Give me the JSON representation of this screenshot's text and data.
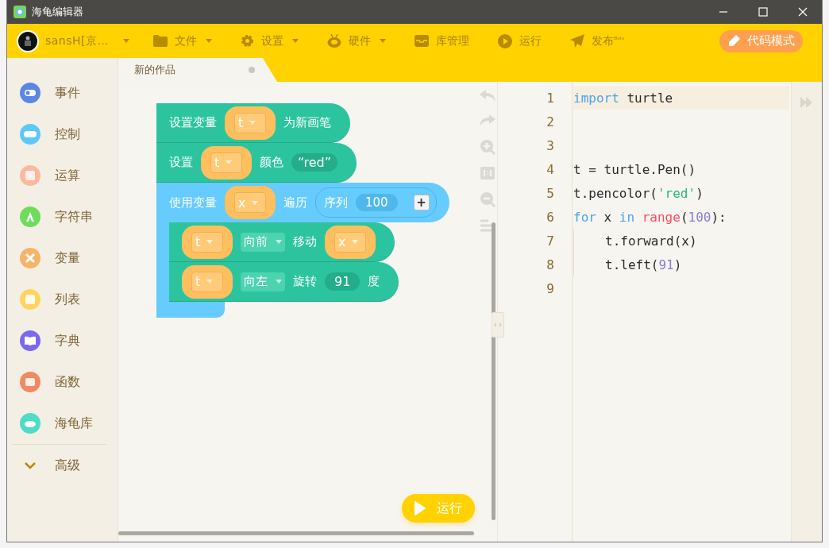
{
  "window": {
    "title": "海龟编辑器"
  },
  "toolbar": {
    "user": {
      "name": "sansH[京…",
      "has_menu": true
    },
    "items": [
      {
        "label": "文件",
        "has_menu": true
      },
      {
        "label": "设置",
        "has_menu": true
      },
      {
        "label": "硬件",
        "has_menu": true
      },
      {
        "label": "库管理",
        "has_menu": false
      },
      {
        "label": "运行",
        "has_menu": false
      },
      {
        "label": "发布",
        "has_menu": false,
        "badge": "Beta"
      }
    ],
    "mode_button": "代码模式"
  },
  "tabs": [
    {
      "label": "新的作品",
      "selected": true
    }
  ],
  "categories": [
    {
      "label": "事件",
      "color": "#5b86e5"
    },
    {
      "label": "控制",
      "color": "#5cc8f8"
    },
    {
      "label": "运算",
      "color": "#f9b9a0"
    },
    {
      "label": "字符串",
      "color": "#6fdc5c"
    },
    {
      "label": "变量",
      "color": "#f5b46a"
    },
    {
      "label": "列表",
      "color": "#ffd45e"
    },
    {
      "label": "字典",
      "color": "#7b68ee"
    },
    {
      "label": "函数",
      "color": "#ef8a62"
    },
    {
      "label": "海龟库",
      "color": "#4fdcc4"
    }
  ],
  "advanced": {
    "label": "高级",
    "expanded": false
  },
  "blocks": [
    {
      "kind": "statement",
      "parts": [
        {
          "kind": "text",
          "text": "设置变量"
        },
        {
          "kind": "var",
          "text": "t"
        },
        {
          "kind": "text",
          "text": "为新画笔"
        }
      ]
    },
    {
      "kind": "statement",
      "parts": [
        {
          "kind": "text",
          "text": "设置"
        },
        {
          "kind": "var",
          "text": "t"
        },
        {
          "kind": "text",
          "text": "颜色"
        },
        {
          "kind": "string",
          "text": "“red”"
        }
      ]
    },
    {
      "kind": "loop",
      "parts": [
        {
          "kind": "text",
          "text": "使用变量"
        },
        {
          "kind": "var",
          "text": "x"
        },
        {
          "kind": "text",
          "text": "遍历"
        },
        {
          "kind": "sequence",
          "text": "序列",
          "value": "100",
          "plus": "+"
        }
      ],
      "children": [
        {
          "kind": "statement",
          "parts": [
            {
              "kind": "var",
              "text": "t"
            },
            {
              "kind": "dropdown",
              "text": "向前"
            },
            {
              "kind": "text",
              "text": "移动"
            },
            {
              "kind": "var",
              "text": "x"
            }
          ]
        },
        {
          "kind": "statement",
          "parts": [
            {
              "kind": "var",
              "text": "t"
            },
            {
              "kind": "dropdown",
              "text": "向左"
            },
            {
              "kind": "text",
              "text": "旋转"
            },
            {
              "kind": "number",
              "text": "91"
            },
            {
              "kind": "text",
              "text": "度"
            }
          ]
        }
      ]
    }
  ],
  "run_button": "运行",
  "code": [
    {
      "number": "1",
      "selected": true,
      "tokens": [
        {
          "kind": "keyword",
          "text": "import"
        },
        {
          "kind": "plain",
          "text": " turtle"
        }
      ]
    },
    {
      "number": "2",
      "selected": false
    },
    {
      "number": "3",
      "selected": false
    },
    {
      "number": "4",
      "selected": false,
      "tokens": [
        {
          "kind": "plain",
          "text": "t = turtle.Pen()"
        }
      ]
    },
    {
      "number": "5",
      "selected": false,
      "tokens": [
        {
          "kind": "plain",
          "text": "t.pencolor("
        },
        {
          "kind": "string",
          "text": "'red'"
        },
        {
          "kind": "plain",
          "text": ")"
        }
      ]
    },
    {
      "number": "6",
      "selected": false,
      "tokens": [
        {
          "kind": "keyword",
          "text": "for"
        },
        {
          "kind": "plain",
          "text": " x "
        },
        {
          "kind": "keyword",
          "text": "in"
        },
        {
          "kind": "builtin",
          "text": " range"
        },
        {
          "kind": "plain",
          "text": "("
        },
        {
          "kind": "number",
          "text": "100"
        },
        {
          "kind": "plain",
          "text": "):"
        }
      ]
    },
    {
      "number": "7",
      "selected": false,
      "indent": true,
      "tokens": [
        {
          "kind": "plain",
          "text": "t.forward(x)"
        }
      ]
    },
    {
      "number": "8",
      "selected": false,
      "indent": true,
      "tokens": [
        {
          "kind": "plain",
          "text": "t.left("
        },
        {
          "kind": "number",
          "text": "91"
        },
        {
          "kind": "plain",
          "text": ")"
        }
      ]
    },
    {
      "number": "9",
      "selected": false
    }
  ]
}
